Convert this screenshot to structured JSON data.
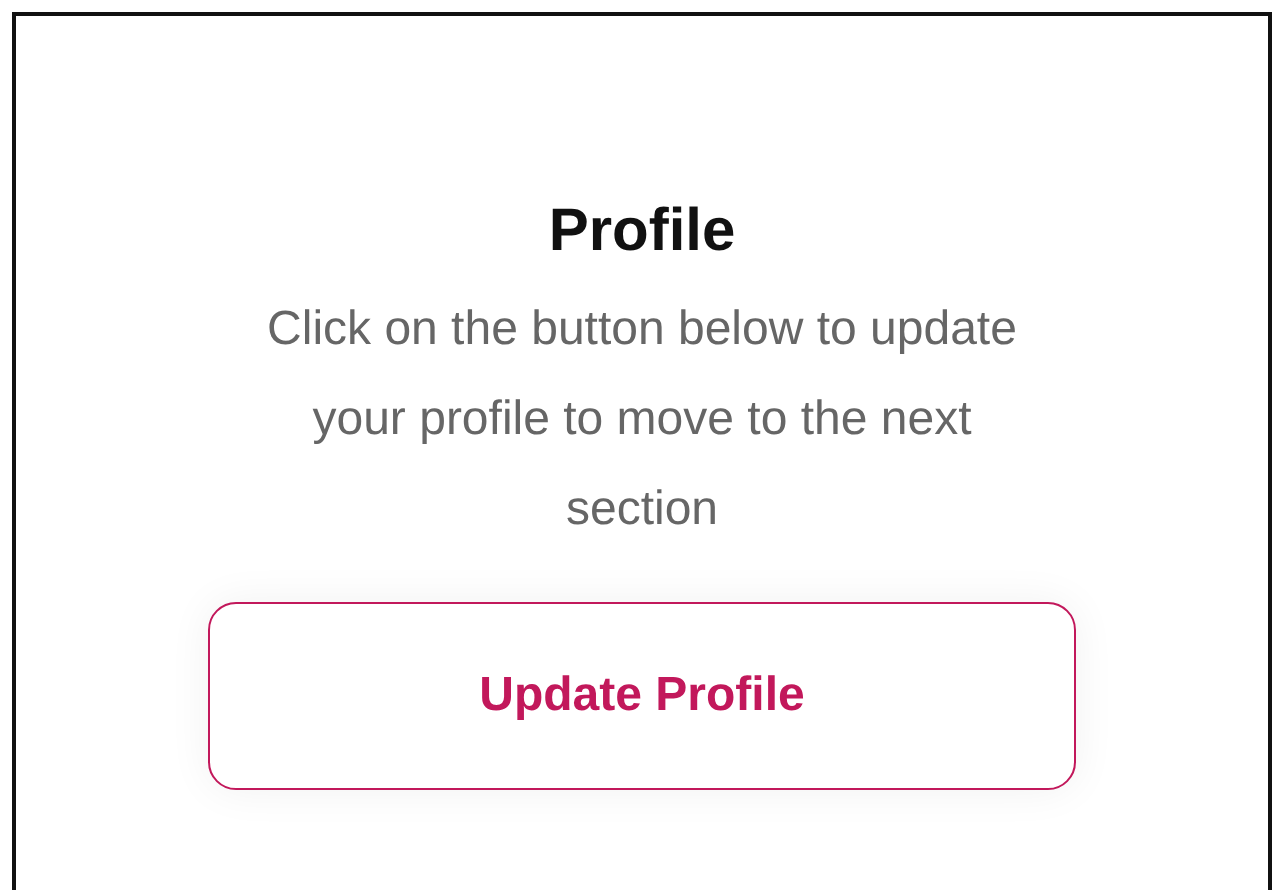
{
  "card": {
    "title": "Profile",
    "description": "Click on the button below to update your profile to move to the next section",
    "button": "Update Profile"
  }
}
